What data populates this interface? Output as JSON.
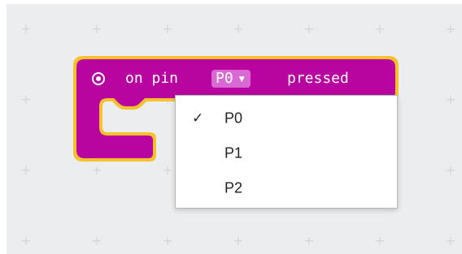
{
  "block": {
    "event_prefix": "on pin",
    "event_suffix": "pressed",
    "selected_pin": "P0",
    "block_color": "#b8059f",
    "outline_color": "#f5c22c",
    "field_color": "#d96ad4",
    "icon": "radio-target-icon",
    "dropdown_icon": "triangle-down-icon"
  },
  "dropdown": {
    "options": [
      {
        "label": "P0",
        "selected": true
      },
      {
        "label": "P1",
        "selected": false
      },
      {
        "label": "P2",
        "selected": false
      }
    ],
    "check_mark": "✓"
  },
  "workspace": {
    "background": "#ecedee",
    "grid_color": "#d4d5d8",
    "grid_glyph": "+"
  }
}
